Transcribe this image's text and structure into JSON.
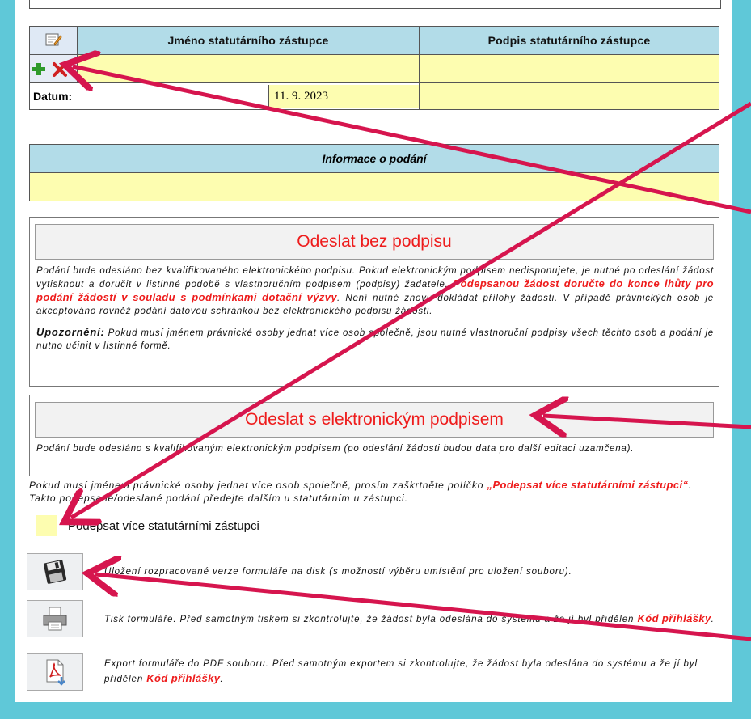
{
  "signature_table": {
    "header_name": "Jméno statutárního zástupce",
    "header_signature": "Podpis statutárního zástupce",
    "name_value": "",
    "signature_value": "",
    "date_label": "Datum:",
    "date_value": "11. 9. 2023"
  },
  "info": {
    "title": "Informace o podání",
    "value": ""
  },
  "send_unsigned": {
    "title": "Odeslat bez podpisu",
    "text1": "Podání bude odesláno bez kvalifikovaného elektronického podpisu. Pokud elektronickým podpisem nedisponujete, je nutné po odeslání žádost vytisknout a doručit v listinné podobě s vlastnoručním podpisem (podpisy) žadatele.",
    "text_red": "Podepsanou žádost doručte do konce lhůty pro podání žádostí v souladu s podmínkami dotační výzvy",
    "text2": ". Není nutné znovu dokládat přílohy žádosti. V případě právnických osob je akceptováno rovněž podání datovou schránkou bez elektronického podpisu žádosti.",
    "warn_label": "Upozornění:",
    "warn_text": " Pokud musí jménem právnické osoby jednat více osob společně, jsou nutné vlastnoruční podpisy všech těchto osob a podání je nutno učinit v listinné formě."
  },
  "send_signed": {
    "title": "Odeslat s elektronickým podpisem",
    "text": "Podání bude odesláno s kvalifikovaným elektronickým podpisem (po odeslání žádosti budou data pro další editaci uzamčena)."
  },
  "multi_sign": {
    "note_pre": "Pokud musí jménem právnické osoby jednat více osob společně, prosím zaškrtněte políčko ",
    "note_red": "„Podepsat více statutárními zástupci“",
    "note_post": ". Takto podepsané/odeslané podání předejte dalším u statutárním u zástupci.",
    "checkbox_label": "Podepsat více statutárními zástupci"
  },
  "actions": {
    "save_text": "Uložení rozpracované verze formuláře na disk (s možností výběru umístění pro uložení souboru).",
    "print_pre": "Tisk formuláře. Před samotným tiskem si zkontrolujte, že žádost byla odeslána do systému a že jí byl přidělen ",
    "print_red": "Kód přihlášky",
    "print_post": ".",
    "pdf_pre": "Export formuláře do PDF souboru. Před samotným exportem si zkontrolujte, že žádost byla odeslána do systému a že jí byl přidělen ",
    "pdf_red": "Kód přihlášky",
    "pdf_post": "."
  },
  "icons": {
    "header": "edit-form-icon",
    "add": "plus-icon",
    "remove": "delete-icon",
    "save": "floppy-disk-icon",
    "print": "printer-icon",
    "pdf": "pdf-export-icon"
  },
  "colors": {
    "background": "#5fc8d8",
    "header_fill": "#b2dce8",
    "input_fill": "#fdfdb0",
    "accent_red": "#ee1c1c",
    "arrow": "#d6154e"
  }
}
